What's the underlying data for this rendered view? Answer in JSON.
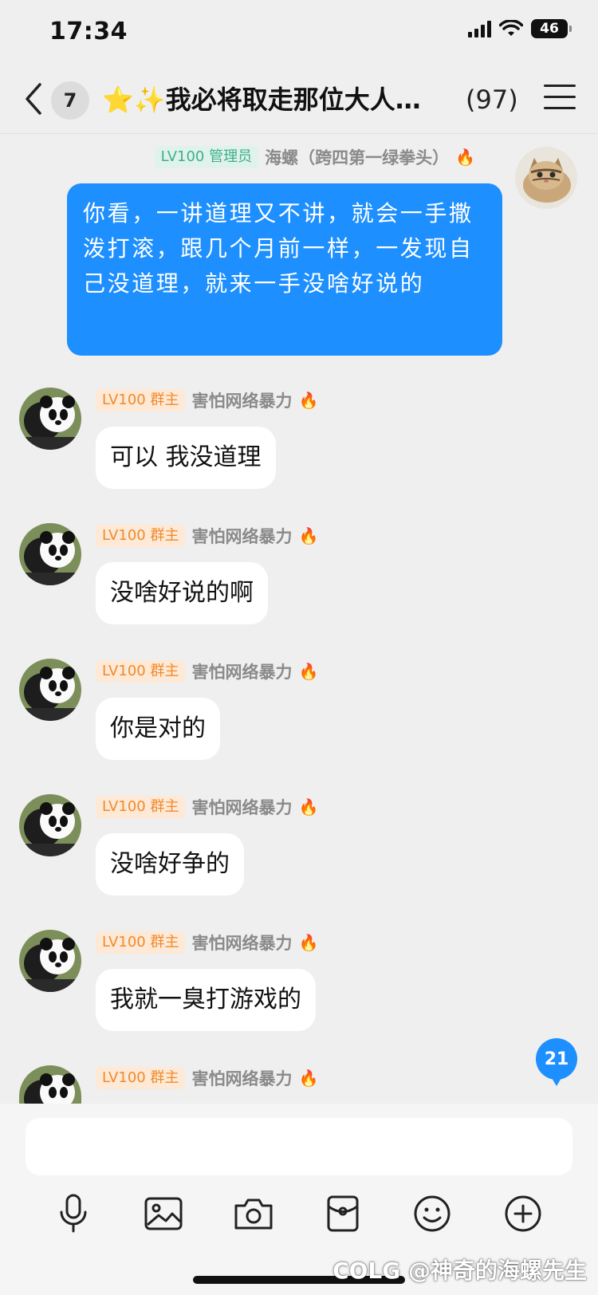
{
  "status_bar": {
    "time": "17:34",
    "battery": "46"
  },
  "nav": {
    "unread": "7",
    "title": "⭐✨我必将取走那位大人…",
    "member_count": "(97)"
  },
  "my_message": {
    "badge": "LV100 管理员",
    "sender": "海螺（跨四第一绿拳头）",
    "text": "你看，一讲道理又不讲，就会一手撒泼打滚，跟几个月前一样，一发现自己没道理，就来一手没啥好说的"
  },
  "messages": [
    {
      "badge": "LV100 群主",
      "sender": "害怕网络暴力",
      "text": "可以  我没道理"
    },
    {
      "badge": "LV100 群主",
      "sender": "害怕网络暴力",
      "text": "没啥好说的啊"
    },
    {
      "badge": "LV100 群主",
      "sender": "害怕网络暴力",
      "text": "你是对的"
    },
    {
      "badge": "LV100 群主",
      "sender": "害怕网络暴力",
      "text": "没啥好争的"
    },
    {
      "badge": "LV100 群主",
      "sender": "害怕网络暴力",
      "text": "我就一臭打游戏的"
    },
    {
      "badge": "LV100 群主",
      "sender": "害怕网络暴力"
    }
  ],
  "new_messages_badge": "21",
  "toolbar": {
    "icons": [
      "microphone-icon",
      "image-icon",
      "camera-icon",
      "red-packet-icon",
      "emoji-icon",
      "plus-icon"
    ]
  },
  "watermark": "COLG @神奇的海螺先生",
  "colors": {
    "accent": "#1e8fff",
    "owner_badge": "#f08a2c",
    "admin_badge": "#3fae8c"
  }
}
